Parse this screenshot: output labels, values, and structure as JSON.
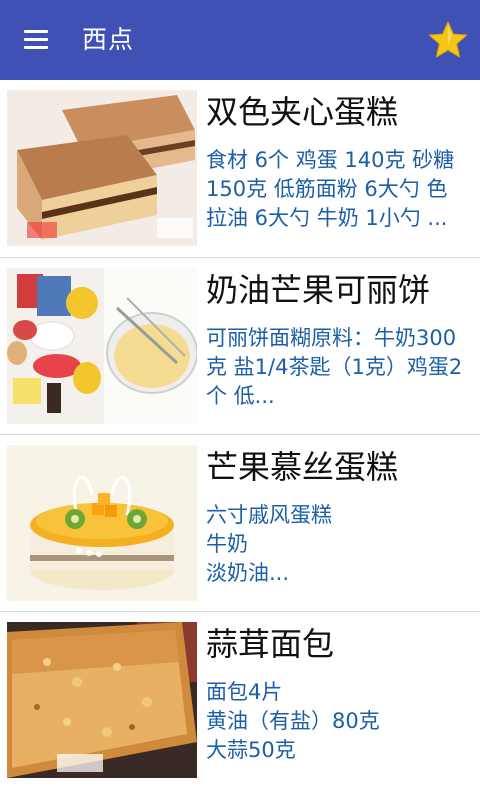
{
  "appbar": {
    "title": "西点",
    "menu_icon": "hamburger-menu-icon",
    "favorite_icon": "star-icon",
    "star_color": "#f5c518",
    "bar_color": "#3f51b5"
  },
  "recipes": [
    {
      "name": "双色夹心蛋糕",
      "desc": "食材 6个 鸡蛋 140克 砂糖 150克 低筋面粉 6大勺 色拉油 6大勺 牛奶 1小勺 ..."
    },
    {
      "name": "奶油芒果可丽饼",
      "desc": "可丽饼面糊原料：牛奶300克 盐1/4茶匙（1克）鸡蛋2个 低..."
    },
    {
      "name": "芒果慕丝蛋糕",
      "desc": "六寸戚风蛋糕\n牛奶\n淡奶油..."
    },
    {
      "name": "蒜茸面包",
      "desc": "面包4片\n黄油（有盐）80克\n大蒜50克"
    }
  ],
  "desc_color": "#1c5fa8"
}
